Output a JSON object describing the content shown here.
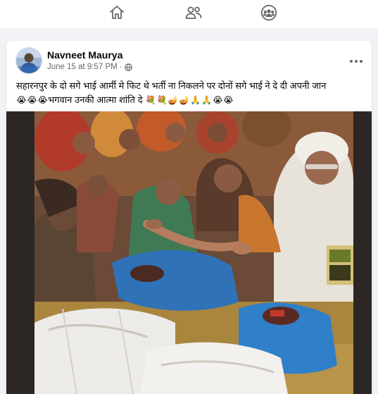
{
  "nav": {
    "items": [
      {
        "name": "home",
        "icon": "home-icon"
      },
      {
        "name": "friends",
        "icon": "friends-icon"
      },
      {
        "name": "groups",
        "icon": "groups-icon"
      }
    ],
    "accent": "#65676b"
  },
  "post": {
    "author": "Navneet Maurya",
    "timestamp": "June 15 at 9:57 PM",
    "separator": "·",
    "privacy_icon": "globe-icon",
    "more_icon": "more-dots-icon",
    "caption_line1": "सहारनपुर के दो सगे भाई आर्मी मे फिट थे भर्ती ना निकलने पर दोनों सगे भाई ने दे दी अपनी जान",
    "caption_line2_text": "भगवान उनकी आत्मा शांति दे",
    "emojis_leading": [
      "😭",
      "😭",
      "😭"
    ],
    "emojis_trailing": [
      "💐",
      "💐",
      "🪔",
      "🪔",
      "🙏",
      "🙏",
      "😭",
      "😭"
    ],
    "image_description_icon": "photo-grieving-family"
  }
}
